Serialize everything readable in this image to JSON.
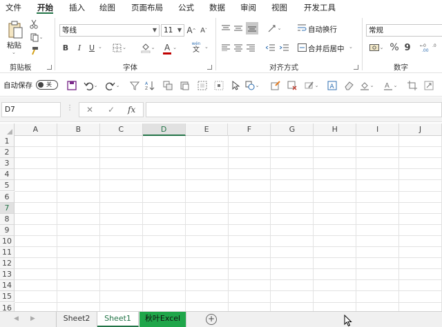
{
  "menu": {
    "tabs": [
      "文件",
      "开始",
      "插入",
      "绘图",
      "页面布局",
      "公式",
      "数据",
      "审阅",
      "视图",
      "开发工具"
    ],
    "active": "开始"
  },
  "ribbon": {
    "clipboard": {
      "paste_label": "粘贴",
      "group_label": "剪贴板"
    },
    "font": {
      "font_name": "等线",
      "font_size": "11",
      "bold": "B",
      "italic": "I",
      "underline": "U",
      "grow_font": "A",
      "shrink_font": "A",
      "font_color_glyph": "A",
      "wen_glyph": "wén",
      "wen_char": "文",
      "group_label": "字体"
    },
    "alignment": {
      "wrap_text": "自动换行",
      "merge_center": "合并后居中",
      "group_label": "对齐方式"
    },
    "number": {
      "format": "常规",
      "percent": "%",
      "comma": "9",
      "group_label": "数字"
    }
  },
  "qat": {
    "autosave_label": "自动保存",
    "autosave_state": "关"
  },
  "formula_bar": {
    "name_box": "D7",
    "cancel_glyph": "✕",
    "enter_glyph": "✓",
    "fx_glyph": "fx",
    "value": ""
  },
  "grid": {
    "columns": [
      "A",
      "B",
      "C",
      "D",
      "E",
      "F",
      "G",
      "H",
      "I",
      "J"
    ],
    "rows": [
      "1",
      "2",
      "3",
      "4",
      "5",
      "6",
      "7",
      "8",
      "9",
      "10",
      "11",
      "12",
      "13",
      "14",
      "15",
      "16"
    ]
  },
  "sheets": {
    "tabs": [
      "Sheet2",
      "Sheet1",
      "秋叶Excel"
    ],
    "active": "Sheet1",
    "add_glyph": "+"
  },
  "colors": {
    "accent": "#217346",
    "highlight_tab": "#1fa64a",
    "font_color_bar": "#c00000"
  }
}
